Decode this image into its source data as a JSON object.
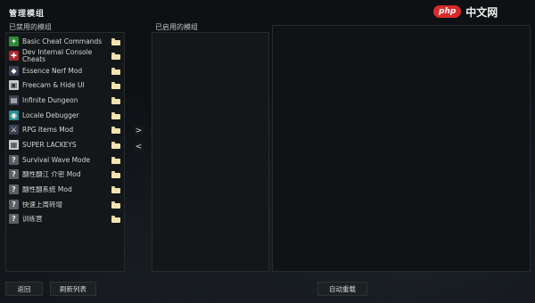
{
  "window": {
    "title": "管理模组"
  },
  "watermark": {
    "badge": "php",
    "text": "中文网"
  },
  "panels": {
    "disabled_label": "已禁用的模组",
    "enabled_label": "已启用的模组"
  },
  "mods": [
    {
      "name": "Basic Cheat Commands",
      "icon": "cheat-icon",
      "color": "green"
    },
    {
      "name": "Dev Internal Console Cheats",
      "icon": "console-icon",
      "color": "red"
    },
    {
      "name": "Essence Nerf Mod",
      "icon": "essence-icon",
      "color": "dark"
    },
    {
      "name": "Freecam & Hide UI",
      "icon": "freecam-icon",
      "color": "light"
    },
    {
      "name": "Infinite Dungeon",
      "icon": "dungeon-icon",
      "color": "dark"
    },
    {
      "name": "Locale Debugger",
      "icon": "locale-icon",
      "color": "teal"
    },
    {
      "name": "RPG Items Mod",
      "icon": "rpg-icon",
      "color": "dark"
    },
    {
      "name": "SUPER LACKEYS",
      "icon": "lackeys-icon",
      "color": "light"
    },
    {
      "name": "Survival Wave Mode",
      "icon": "question-icon",
      "color": "grey"
    },
    {
      "name": "翻性翻江 介密 Mod",
      "icon": "question-icon",
      "color": "grey"
    },
    {
      "name": "翻性翻系统 Mod",
      "icon": "question-icon",
      "color": "grey"
    },
    {
      "name": "快速上周转增",
      "icon": "question-icon",
      "color": "grey"
    },
    {
      "name": "训练营",
      "icon": "question-icon",
      "color": "grey"
    }
  ],
  "transfer": {
    "enable_symbol": ">",
    "disable_symbol": "<"
  },
  "buttons": {
    "back": "返回",
    "refresh": "刷新列表",
    "auto_sort": "自动重载"
  }
}
